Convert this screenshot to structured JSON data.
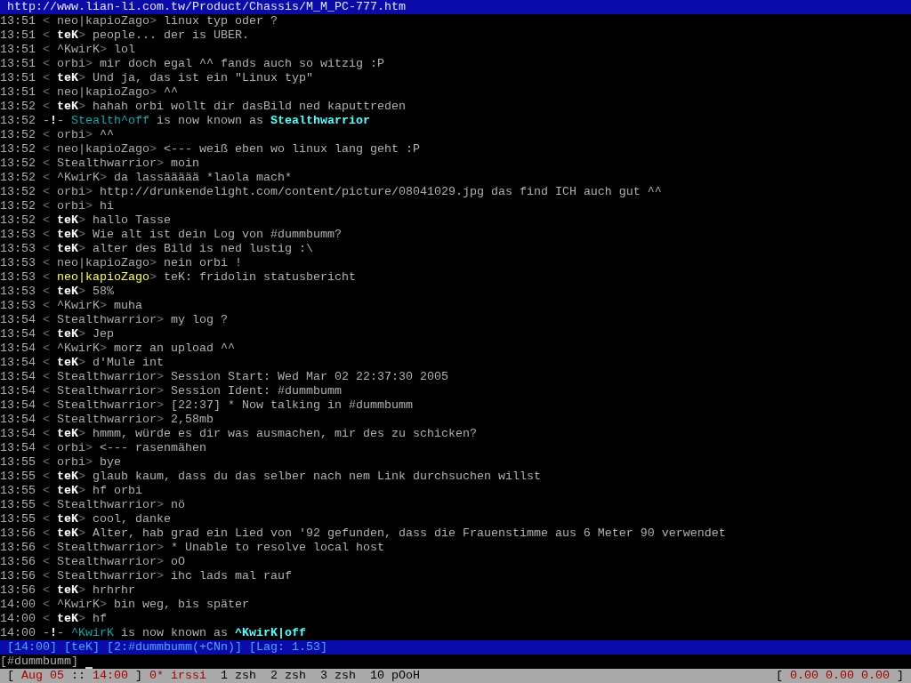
{
  "topic_bar": {
    "text": "http://www.lian-li.com.tw/Product/Chassis/M_M_PC-777.htm"
  },
  "messages": [
    {
      "kind": "message",
      "time": "13:51",
      "bracket_open": "<",
      "nick": "neo|kapioZago",
      "bracket_close": ">",
      "text": "linux typ oder ?",
      "own": false,
      "hilight": false
    },
    {
      "kind": "message",
      "time": "13:51",
      "bracket_open": "<",
      "nick": "teK",
      "bracket_close": ">",
      "text": "people... der is UBER.",
      "own": true,
      "hilight": false
    },
    {
      "kind": "message",
      "time": "13:51",
      "bracket_open": "<",
      "nick": "^KwirK",
      "bracket_close": ">",
      "text": "lol",
      "own": false,
      "hilight": false
    },
    {
      "kind": "message",
      "time": "13:51",
      "bracket_open": "<",
      "nick": "orbi",
      "bracket_close": ">",
      "text": "mir doch egal ^^ fands auch so witzig :P",
      "own": false,
      "hilight": false
    },
    {
      "kind": "message",
      "time": "13:51",
      "bracket_open": "<",
      "nick": "teK",
      "bracket_close": ">",
      "text": "Und ja, das ist ein \"Linux typ\"",
      "own": true,
      "hilight": false
    },
    {
      "kind": "message",
      "time": "13:51",
      "bracket_open": "<",
      "nick": "neo|kapioZago",
      "bracket_close": ">",
      "text": "^^",
      "own": false,
      "hilight": false
    },
    {
      "kind": "message",
      "time": "13:52",
      "bracket_open": "<",
      "nick": "teK",
      "bracket_close": ">",
      "text": "hahah orbi wollt dir dasBild ned kaputtreden",
      "own": true,
      "hilight": false
    },
    {
      "kind": "nick_change",
      "time": "13:52",
      "marker": "-**!**-",
      "old_nick": "Stealth^off",
      "phrase": "is now known as",
      "new_nick": "Stealthwarrior"
    },
    {
      "kind": "message",
      "time": "13:52",
      "bracket_open": "<",
      "nick": "orbi",
      "bracket_close": ">",
      "text": "^^",
      "own": false,
      "hilight": false
    },
    {
      "kind": "message",
      "time": "13:52",
      "bracket_open": "<",
      "nick": "neo|kapioZago",
      "bracket_close": ">",
      "text": "<--- weiß eben wo linux lang geht :P",
      "own": false,
      "hilight": false
    },
    {
      "kind": "message",
      "time": "13:52",
      "bracket_open": "<",
      "nick": "Stealthwarrior",
      "bracket_close": ">",
      "text": "moin",
      "own": false,
      "hilight": false
    },
    {
      "kind": "message",
      "time": "13:52",
      "bracket_open": "<",
      "nick": "^KwirK",
      "bracket_close": ">",
      "text": "da lassäääää *laola mach*",
      "own": false,
      "hilight": false
    },
    {
      "kind": "message",
      "time": "13:52",
      "bracket_open": "<",
      "nick": "orbi",
      "bracket_close": ">",
      "text": "http://drunkendelight.com/content/picture/08041029.jpg das find ICH auch gut ^^",
      "own": false,
      "hilight": false
    },
    {
      "kind": "message",
      "time": "13:52",
      "bracket_open": "<",
      "nick": "orbi",
      "bracket_close": ">",
      "text": "hi",
      "own": false,
      "hilight": false
    },
    {
      "kind": "message",
      "time": "13:52",
      "bracket_open": "<",
      "nick": "teK",
      "bracket_close": ">",
      "text": "hallo Tasse",
      "own": true,
      "hilight": false
    },
    {
      "kind": "message",
      "time": "13:53",
      "bracket_open": "<",
      "nick": "teK",
      "bracket_close": ">",
      "text": "Wie alt ist dein Log von #dummbumm?",
      "own": true,
      "hilight": false
    },
    {
      "kind": "message",
      "time": "13:53",
      "bracket_open": "<",
      "nick": "teK",
      "bracket_close": ">",
      "text": "alter des Bild is ned lustig :\\",
      "own": true,
      "hilight": false
    },
    {
      "kind": "message",
      "time": "13:53",
      "bracket_open": "<",
      "nick": "neo|kapioZago",
      "bracket_close": ">",
      "text": "nein orbi !",
      "own": false,
      "hilight": false
    },
    {
      "kind": "message",
      "time": "13:53",
      "bracket_open": "<",
      "nick": "neo|kapioZago",
      "bracket_close": ">",
      "text": "teK: fridolin statusbericht",
      "own": false,
      "hilight": true
    },
    {
      "kind": "message",
      "time": "13:53",
      "bracket_open": "<",
      "nick": "teK",
      "bracket_close": ">",
      "text": "58%",
      "own": true,
      "hilight": false
    },
    {
      "kind": "message",
      "time": "13:53",
      "bracket_open": "<",
      "nick": "^KwirK",
      "bracket_close": ">",
      "text": "muha",
      "own": false,
      "hilight": false
    },
    {
      "kind": "message",
      "time": "13:54",
      "bracket_open": "<",
      "nick": "Stealthwarrior",
      "bracket_close": ">",
      "text": "my log ?",
      "own": false,
      "hilight": false
    },
    {
      "kind": "message",
      "time": "13:54",
      "bracket_open": "<",
      "nick": "teK",
      "bracket_close": ">",
      "text": "Jep",
      "own": true,
      "hilight": false
    },
    {
      "kind": "message",
      "time": "13:54",
      "bracket_open": "<",
      "nick": "^KwirK",
      "bracket_close": ">",
      "text": "morz an upload ^^",
      "own": false,
      "hilight": false
    },
    {
      "kind": "message",
      "time": "13:54",
      "bracket_open": "<",
      "nick": "teK",
      "bracket_close": ">",
      "text": "d'Mule int",
      "own": true,
      "hilight": false
    },
    {
      "kind": "message",
      "time": "13:54",
      "bracket_open": "<",
      "nick": "Stealthwarrior",
      "bracket_close": ">",
      "text": "Session Start: Wed Mar 02 22:37:30 2005",
      "own": false,
      "hilight": false
    },
    {
      "kind": "message",
      "time": "13:54",
      "bracket_open": "<",
      "nick": "Stealthwarrior",
      "bracket_close": ">",
      "text": "Session Ident: #dummbumm",
      "own": false,
      "hilight": false
    },
    {
      "kind": "message",
      "time": "13:54",
      "bracket_open": "<",
      "nick": "Stealthwarrior",
      "bracket_close": ">",
      "text": "[22:37] * Now talking in #dummbumm",
      "own": false,
      "hilight": false
    },
    {
      "kind": "message",
      "time": "13:54",
      "bracket_open": "<",
      "nick": "Stealthwarrior",
      "bracket_close": ">",
      "text": "2,58mb",
      "own": false,
      "hilight": false
    },
    {
      "kind": "message",
      "time": "13:54",
      "bracket_open": "<",
      "nick": "teK",
      "bracket_close": ">",
      "text": "hmmm, würde es dir was ausmachen, mir des zu schicken?",
      "own": true,
      "hilight": false
    },
    {
      "kind": "message",
      "time": "13:54",
      "bracket_open": "<",
      "nick": "orbi",
      "bracket_close": ">",
      "text": "<--- rasenmähen",
      "own": false,
      "hilight": false
    },
    {
      "kind": "message",
      "time": "13:55",
      "bracket_open": "<",
      "nick": "orbi",
      "bracket_close": ">",
      "text": "bye",
      "own": false,
      "hilight": false
    },
    {
      "kind": "message",
      "time": "13:55",
      "bracket_open": "<",
      "nick": "teK",
      "bracket_close": ">",
      "text": "glaub kaum, dass du das selber nach nem Link durchsuchen willst",
      "own": true,
      "hilight": false
    },
    {
      "kind": "message",
      "time": "13:55",
      "bracket_open": "<",
      "nick": "teK",
      "bracket_close": ">",
      "text": "hf orbi",
      "own": true,
      "hilight": false
    },
    {
      "kind": "message",
      "time": "13:55",
      "bracket_open": "<",
      "nick": "Stealthwarrior",
      "bracket_close": ">",
      "text": "nö",
      "own": false,
      "hilight": false
    },
    {
      "kind": "message",
      "time": "13:55",
      "bracket_open": "<",
      "nick": "teK",
      "bracket_close": ">",
      "text": "cool, danke",
      "own": true,
      "hilight": false
    },
    {
      "kind": "message",
      "time": "13:56",
      "bracket_open": "<",
      "nick": "teK",
      "bracket_close": ">",
      "text": "Alter, hab grad ein Lied von '92 gefunden, dass die Frauenstimme aus 6 Meter 90 verwendet",
      "own": true,
      "hilight": false
    },
    {
      "kind": "message",
      "time": "13:56",
      "bracket_open": "<",
      "nick": "Stealthwarrior",
      "bracket_close": ">",
      "text": "* Unable to resolve local host",
      "own": false,
      "hilight": false
    },
    {
      "kind": "message",
      "time": "13:56",
      "bracket_open": "<",
      "nick": "Stealthwarrior",
      "bracket_close": ">",
      "text": "oO",
      "own": false,
      "hilight": false
    },
    {
      "kind": "message",
      "time": "13:56",
      "bracket_open": "<",
      "nick": "Stealthwarrior",
      "bracket_close": ">",
      "text": "ihc lads mal rauf",
      "own": false,
      "hilight": false
    },
    {
      "kind": "message",
      "time": "13:56",
      "bracket_open": "<",
      "nick": "teK",
      "bracket_close": ">",
      "text": "hrhrhr",
      "own": true,
      "hilight": false
    },
    {
      "kind": "message",
      "time": "14:00",
      "bracket_open": "<",
      "nick": "^KwirK",
      "bracket_close": ">",
      "text": "bin weg, bis später",
      "own": false,
      "hilight": false
    },
    {
      "kind": "message",
      "time": "14:00",
      "bracket_open": "<",
      "nick": "teK",
      "bracket_close": ">",
      "text": "hf",
      "own": true,
      "hilight": false
    },
    {
      "kind": "nick_change",
      "time": "14:00",
      "marker": "-**!**-",
      "old_nick": "^KwirK",
      "phrase": "is now known as",
      "new_nick": "^KwirK|off"
    }
  ],
  "status_bar": {
    "items": [
      "[14:00]",
      "[teK]",
      "[2:#dummbumm(+CNn)]",
      "[Lag: 1.53]"
    ]
  },
  "input_line": {
    "prompt": "[#dummbumm]"
  },
  "screen_bar": {
    "clock": {
      "bracket_open": "[",
      "date": "Aug 05",
      "separator": "::",
      "time": "14:00",
      "bracket_close": "]"
    },
    "windows": [
      {
        "label": "0* irssi",
        "selected": true
      },
      {
        "label": "1 zsh",
        "selected": false
      },
      {
        "label": "2 zsh",
        "selected": false
      },
      {
        "label": "3 zsh",
        "selected": false
      },
      {
        "label": "10 pOoH",
        "selected": false
      }
    ],
    "load": {
      "bracket_open": "[",
      "values": "0.00 0.00 0.00",
      "bracket_close": "]"
    }
  }
}
